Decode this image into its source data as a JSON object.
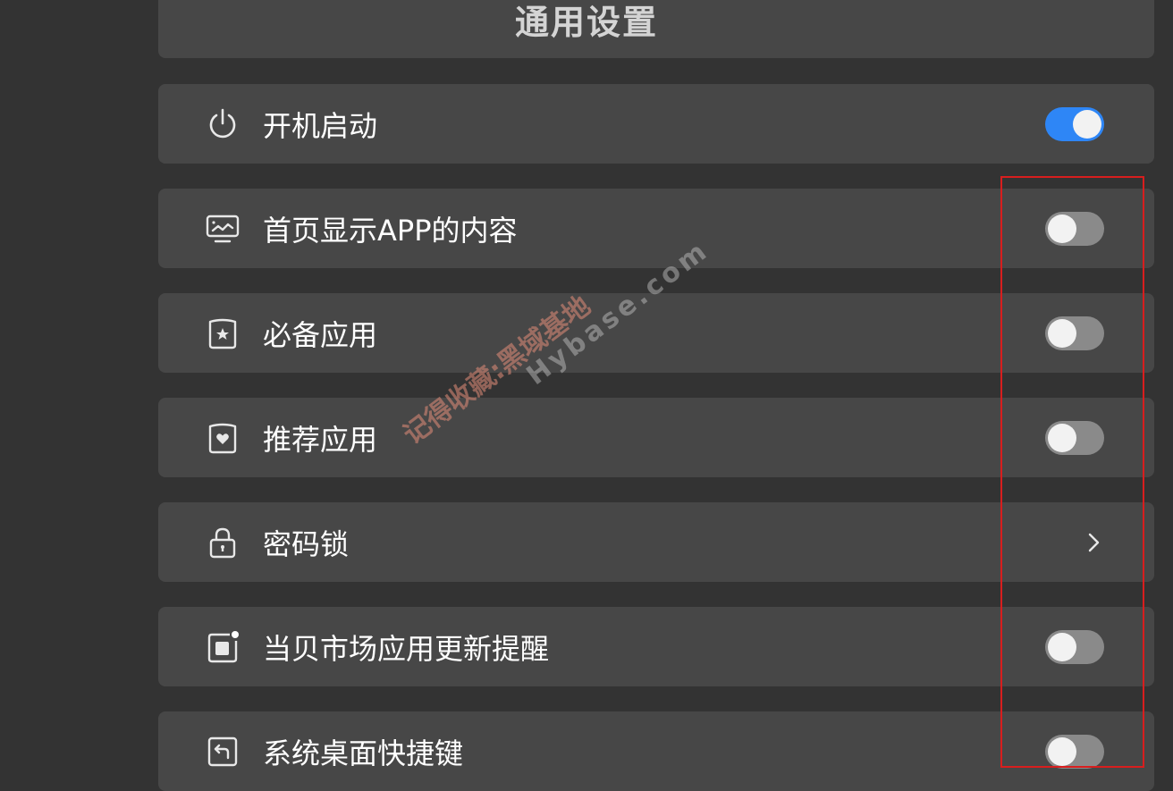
{
  "header": {
    "title": "通用设置"
  },
  "settings": [
    {
      "label": "开机启动",
      "icon": "power-icon",
      "control": "toggle",
      "enabled": true
    },
    {
      "label": "首页显示APP的内容",
      "icon": "monitor-chart-icon",
      "control": "toggle",
      "enabled": false
    },
    {
      "label": "必备应用",
      "icon": "star-shield-icon",
      "control": "toggle",
      "enabled": false
    },
    {
      "label": "推荐应用",
      "icon": "heart-shield-icon",
      "control": "toggle",
      "enabled": false
    },
    {
      "label": "密码锁",
      "icon": "lock-icon",
      "control": "chevron"
    },
    {
      "label": "当贝市场应用更新提醒",
      "icon": "notification-square-icon",
      "control": "toggle",
      "enabled": false
    },
    {
      "label": "系统桌面快捷键",
      "icon": "shortcut-back-icon",
      "control": "toggle",
      "enabled": false
    }
  ],
  "watermark": {
    "line1": "记得收藏:黑域基地",
    "line2": "Hybase.com"
  },
  "colors": {
    "toggle_on": "#2e86f6",
    "toggle_off": "#8a8a8a",
    "row_bg": "#474747",
    "page_bg": "#333333",
    "highlight": "#d81e1e"
  }
}
